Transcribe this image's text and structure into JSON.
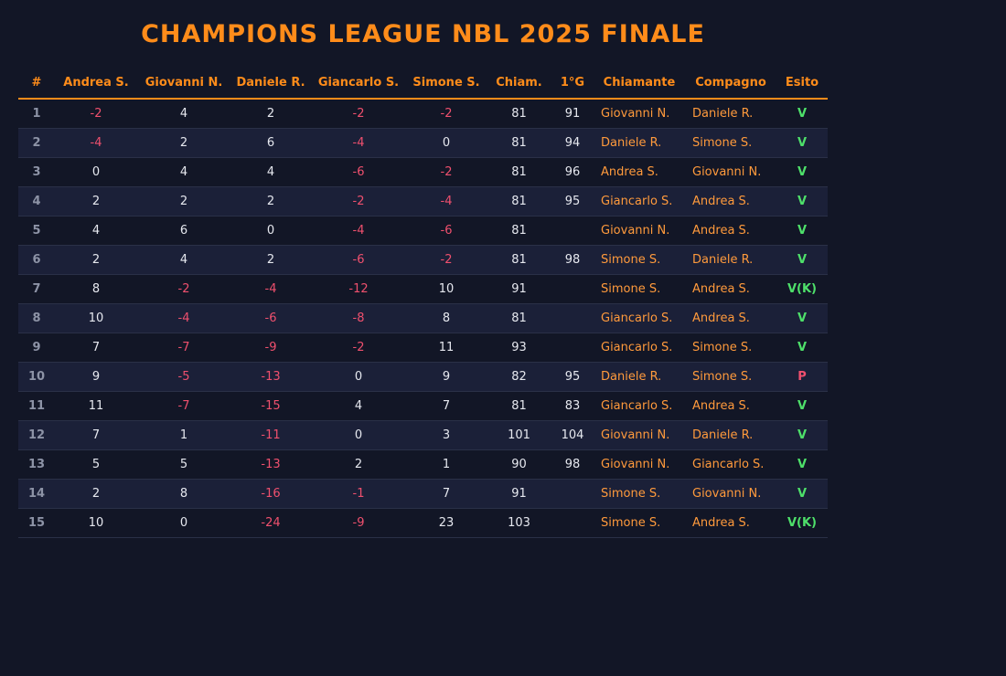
{
  "title": "CHAMPIONS LEAGUE NBL 2025 FINALE",
  "colors": {
    "background": "#121626",
    "accent": "#ff8c1a",
    "negative": "#f0506e",
    "win": "#4ee06a",
    "row_alt": "#1b2038"
  },
  "columns": [
    "#",
    "Andrea S.",
    "Giovanni N.",
    "Daniele R.",
    "Giancarlo S.",
    "Simone S.",
    "Chiam.",
    "1°G",
    "Chiamante",
    "Compagno",
    "Esito"
  ],
  "rows": [
    {
      "n": "1",
      "scores": [
        "-2",
        "4",
        "2",
        "-2",
        "-2"
      ],
      "chiam": "81",
      "primo": "91",
      "chiamante": "Giovanni N.",
      "compagno": "Daniele R.",
      "esito": "V"
    },
    {
      "n": "2",
      "scores": [
        "-4",
        "2",
        "6",
        "-4",
        "0"
      ],
      "chiam": "81",
      "primo": "94",
      "chiamante": "Daniele R.",
      "compagno": "Simone S.",
      "esito": "V"
    },
    {
      "n": "3",
      "scores": [
        "0",
        "4",
        "4",
        "-6",
        "-2"
      ],
      "chiam": "81",
      "primo": "96",
      "chiamante": "Andrea S.",
      "compagno": "Giovanni N.",
      "esito": "V"
    },
    {
      "n": "4",
      "scores": [
        "2",
        "2",
        "2",
        "-2",
        "-4"
      ],
      "chiam": "81",
      "primo": "95",
      "chiamante": "Giancarlo S.",
      "compagno": "Andrea S.",
      "esito": "V"
    },
    {
      "n": "5",
      "scores": [
        "4",
        "6",
        "0",
        "-4",
        "-6"
      ],
      "chiam": "81",
      "primo": "",
      "chiamante": "Giovanni N.",
      "compagno": "Andrea S.",
      "esito": "V"
    },
    {
      "n": "6",
      "scores": [
        "2",
        "4",
        "2",
        "-6",
        "-2"
      ],
      "chiam": "81",
      "primo": "98",
      "chiamante": "Simone S.",
      "compagno": "Daniele R.",
      "esito": "V"
    },
    {
      "n": "7",
      "scores": [
        "8",
        "-2",
        "-4",
        "-12",
        "10"
      ],
      "chiam": "91",
      "primo": "",
      "chiamante": "Simone S.",
      "compagno": "Andrea S.",
      "esito": "V(K)"
    },
    {
      "n": "8",
      "scores": [
        "10",
        "-4",
        "-6",
        "-8",
        "8"
      ],
      "chiam": "81",
      "primo": "",
      "chiamante": "Giancarlo S.",
      "compagno": "Andrea S.",
      "esito": "V"
    },
    {
      "n": "9",
      "scores": [
        "7",
        "-7",
        "-9",
        "-2",
        "11"
      ],
      "chiam": "93",
      "primo": "",
      "chiamante": "Giancarlo S.",
      "compagno": "Simone S.",
      "esito": "V"
    },
    {
      "n": "10",
      "scores": [
        "9",
        "-5",
        "-13",
        "0",
        "9"
      ],
      "chiam": "82",
      "primo": "95",
      "chiamante": "Daniele R.",
      "compagno": "Simone S.",
      "esito": "P"
    },
    {
      "n": "11",
      "scores": [
        "11",
        "-7",
        "-15",
        "4",
        "7"
      ],
      "chiam": "81",
      "primo": "83",
      "chiamante": "Giancarlo S.",
      "compagno": "Andrea S.",
      "esito": "V"
    },
    {
      "n": "12",
      "scores": [
        "7",
        "1",
        "-11",
        "0",
        "3"
      ],
      "chiam": "101",
      "primo": "104",
      "chiamante": "Giovanni N.",
      "compagno": "Daniele R.",
      "esito": "V"
    },
    {
      "n": "13",
      "scores": [
        "5",
        "5",
        "-13",
        "2",
        "1"
      ],
      "chiam": "90",
      "primo": "98",
      "chiamante": "Giovanni N.",
      "compagno": "Giancarlo S.",
      "esito": "V"
    },
    {
      "n": "14",
      "scores": [
        "2",
        "8",
        "-16",
        "-1",
        "7"
      ],
      "chiam": "91",
      "primo": "",
      "chiamante": "Simone S.",
      "compagno": "Giovanni N.",
      "esito": "V"
    },
    {
      "n": "15",
      "scores": [
        "10",
        "0",
        "-24",
        "-9",
        "23"
      ],
      "chiam": "103",
      "primo": "",
      "chiamante": "Simone S.",
      "compagno": "Andrea S.",
      "esito": "V(K)"
    }
  ]
}
